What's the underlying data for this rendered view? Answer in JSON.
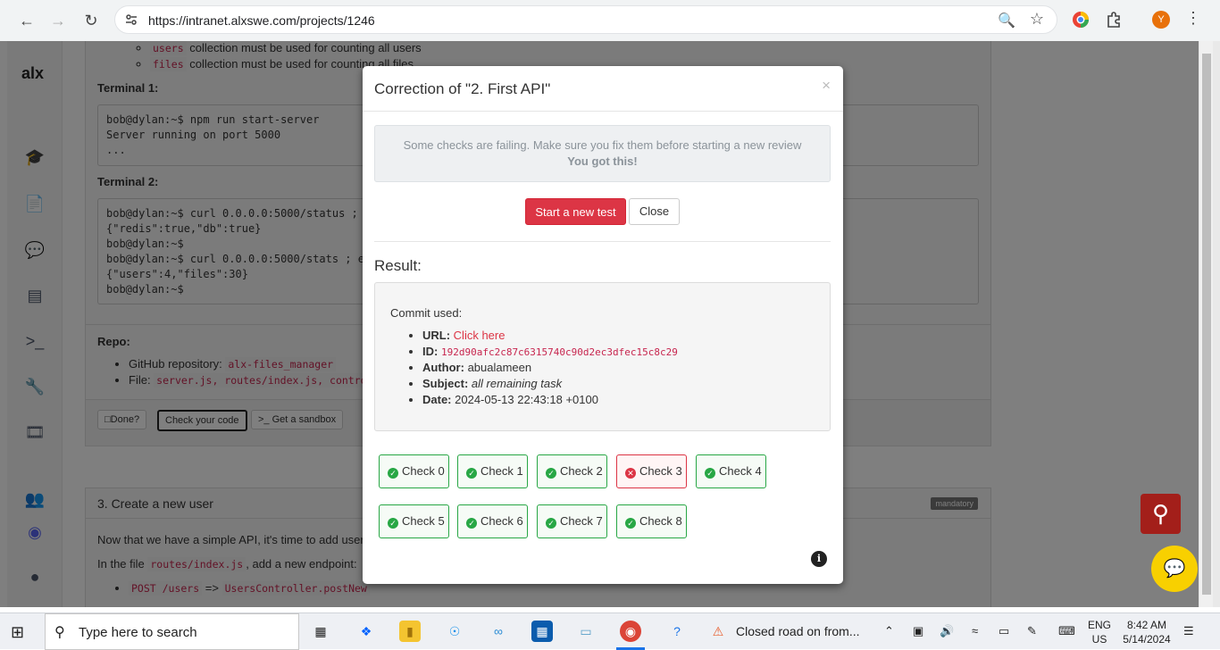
{
  "browser": {
    "url": "https://intranet.alxswe.com/projects/1246",
    "profile_initial": "Y"
  },
  "sidebar": {
    "logo": "alx"
  },
  "background": {
    "bullets": [
      {
        "code": "users",
        "text": " collection must be used for counting all users"
      },
      {
        "code": "files",
        "text": " collection must be used for counting all files"
      }
    ],
    "terminal1_label": "Terminal 1:",
    "terminal1_code": "bob@dylan:~$ npm run start-server\nServer running on port 5000\n...",
    "terminal2_label": "Terminal 2:",
    "terminal2_code": "bob@dylan:~$ curl 0.0.0.0:5000/status ; e\n{\"redis\":true,\"db\":true}\nbob@dylan:~$\nbob@dylan:~$ curl 0.0.0.0:5000/stats ; ec\n{\"users\":4,\"files\":30}\nbob@dylan:~$",
    "repo_label": "Repo:",
    "repo_items": [
      {
        "label": "GitHub repository: ",
        "code": "alx-files_manager"
      },
      {
        "label": "File: ",
        "code": "server.js, routes/index.js, contro"
      }
    ],
    "done_label": "Done?",
    "check_code_label": "Check your code",
    "sandbox_label": "Get a sandbox",
    "task3_title": "3. Create a new user",
    "task3_badge": "mandatory",
    "task3_p1": "Now that we have a simple API, it's time to add users",
    "task3_p2_pre": "In the file ",
    "task3_p2_code": "routes/index.js",
    "task3_p2_post": ", add a new endpoint:",
    "task3_bullet_code1": "POST /users",
    "task3_bullet_arrow": " => ",
    "task3_bullet_code2": "UsersController.postNew"
  },
  "modal": {
    "title": "Correction of \"2. First API\"",
    "close_symbol": "×",
    "alert_line1": "Some checks are failing. Make sure you fix them before starting a new review",
    "alert_line2": "You got this!",
    "start_test_label": "Start a new test",
    "close_label": "Close",
    "result_title": "Result:",
    "commit_used": "Commit used:",
    "commit": {
      "url_label": "URL:",
      "url_text": "Click here",
      "id_label": "ID:",
      "id_value": "192d90afc2c87c6315740c90d2ec3dfec15c8c29",
      "author_label": "Author:",
      "author_value": "abualameen",
      "subject_label": "Subject:",
      "subject_value": "all remaining task",
      "date_label": "Date:",
      "date_value": "2024-05-13 22:43:18 +0100"
    },
    "checks": [
      {
        "label": "Check 0",
        "status": "pass"
      },
      {
        "label": "Check 1",
        "status": "pass"
      },
      {
        "label": "Check 2",
        "status": "pass"
      },
      {
        "label": "Check 3",
        "status": "fail"
      },
      {
        "label": "Check 4",
        "status": "pass"
      },
      {
        "label": "Check 5",
        "status": "pass"
      },
      {
        "label": "Check 6",
        "status": "pass"
      },
      {
        "label": "Check 7",
        "status": "pass"
      },
      {
        "label": "Check 8",
        "status": "pass"
      }
    ]
  },
  "taskbar": {
    "search_placeholder": "Type here to search",
    "news": "Closed road on from...",
    "lang_line1": "ENG",
    "lang_line2": "US",
    "time": "8:42 AM",
    "date": "5/14/2024"
  },
  "colors": {
    "danger": "#dc3545",
    "success": "#28a745",
    "brand_yellow": "#f8d000"
  }
}
